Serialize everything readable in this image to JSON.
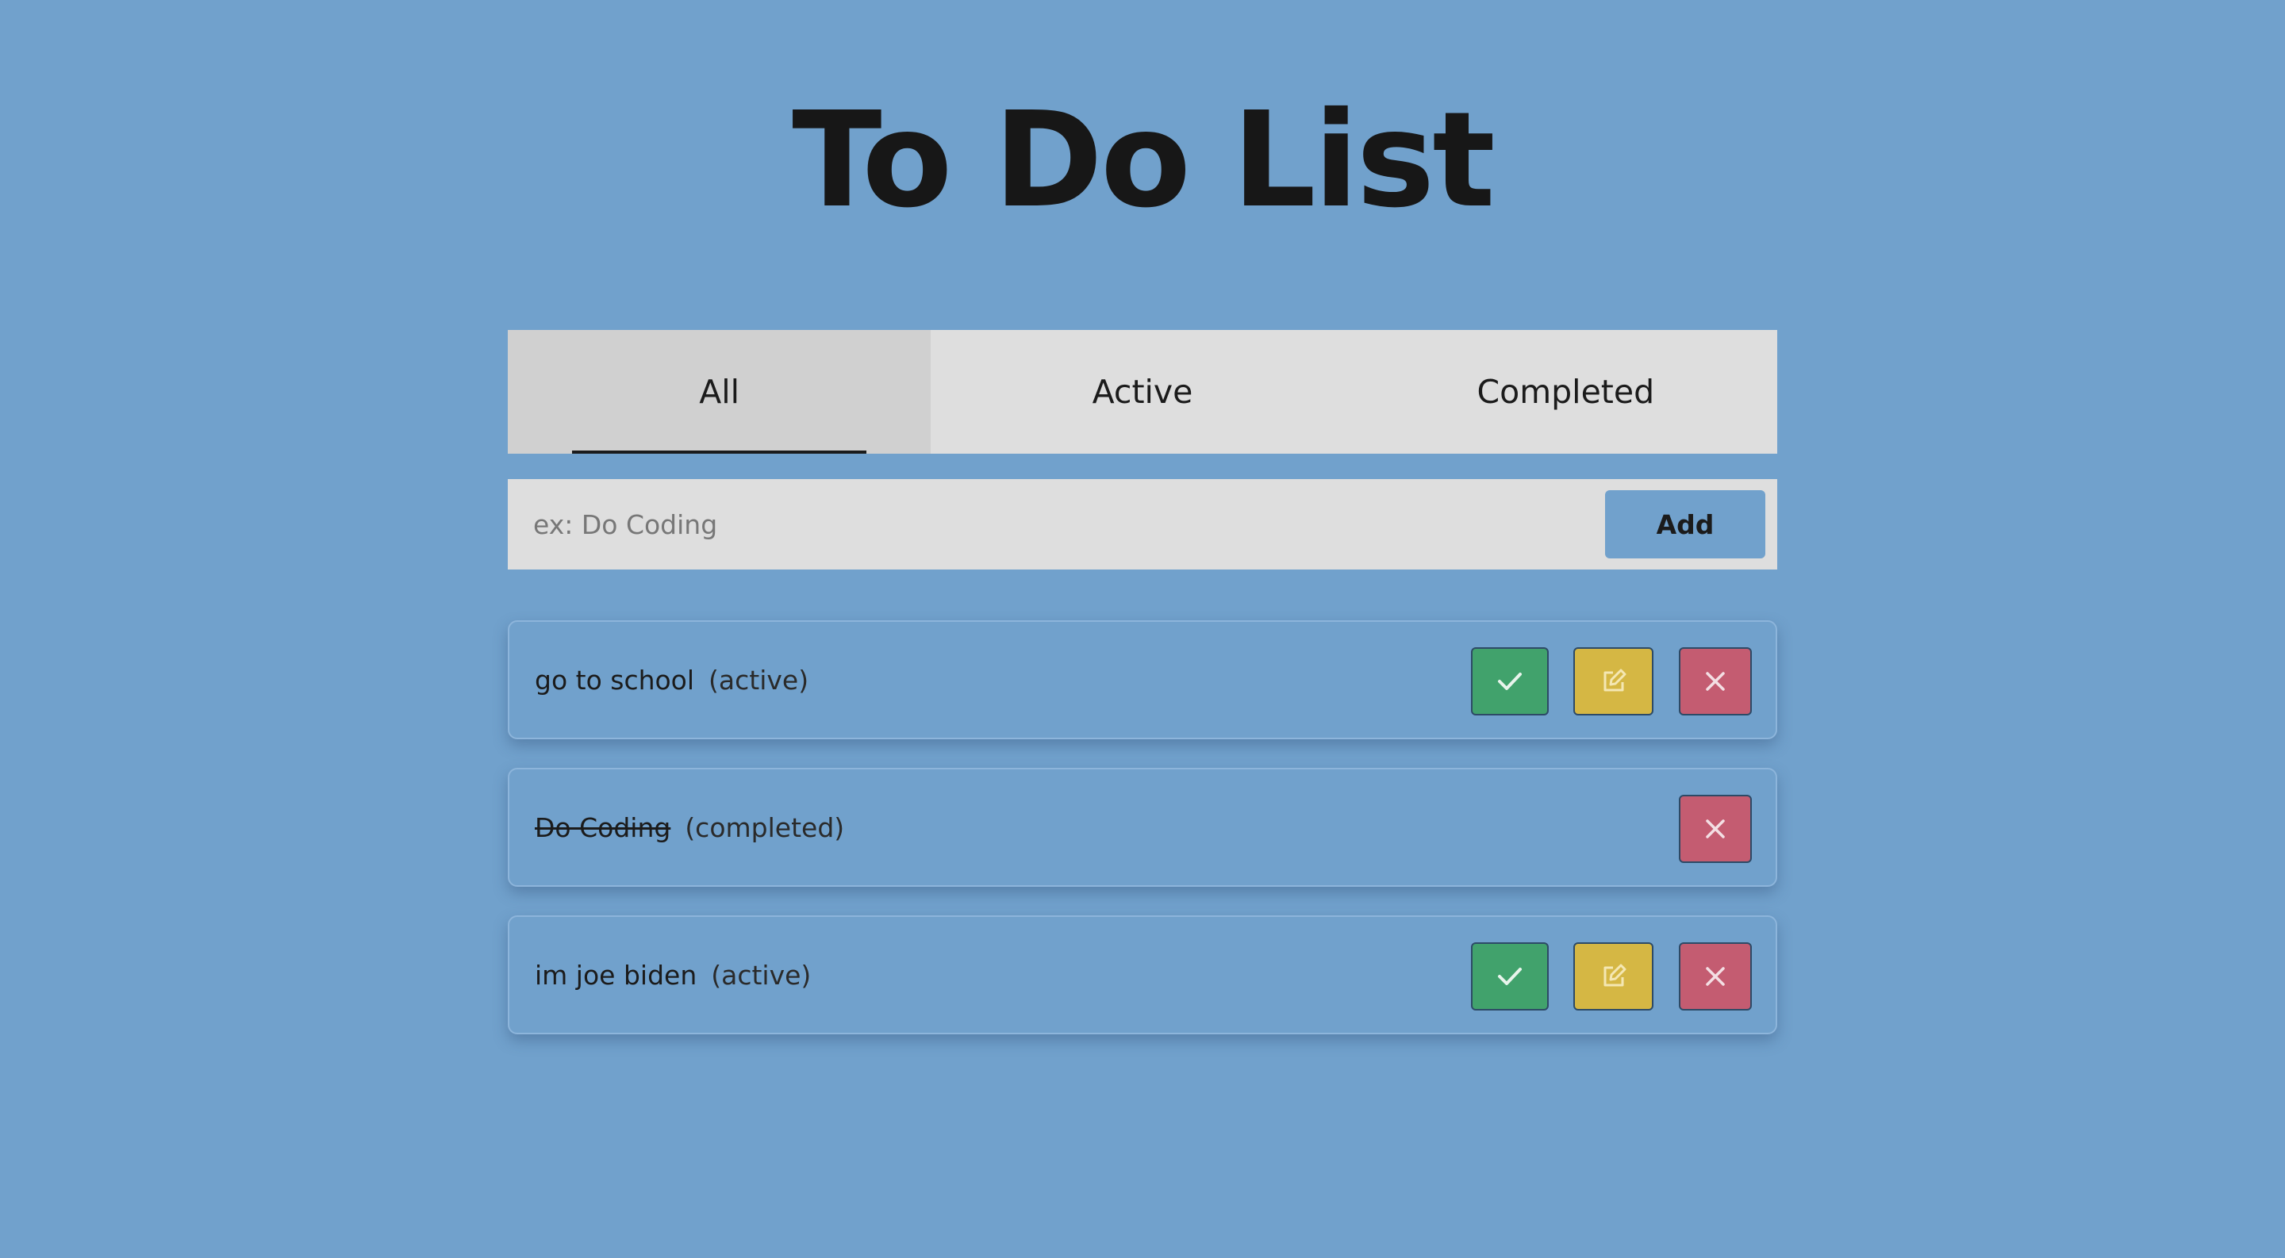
{
  "app": {
    "title": "To Do List",
    "colors": {
      "background": "#71a1cc",
      "panel": "#dedede",
      "selected_tab": "#d0d0d0",
      "complete_button": "#41a26c",
      "edit_button": "#d5b744",
      "delete_button": "#c45c71"
    }
  },
  "tabs": [
    {
      "label": "All",
      "selected": true
    },
    {
      "label": "Active",
      "selected": false
    },
    {
      "label": "Completed",
      "selected": false
    }
  ],
  "add_form": {
    "placeholder": "ex: Do Coding",
    "value": "",
    "button_label": "Add"
  },
  "todos": [
    {
      "text": "go to school",
      "status": "(active)",
      "completed": false,
      "icons": [
        "check-icon",
        "edit-icon",
        "close-icon"
      ]
    },
    {
      "text": "Do Coding",
      "status": "(completed)",
      "completed": true,
      "icons": [
        "close-icon"
      ]
    },
    {
      "text": "im joe biden",
      "status": "(active)",
      "completed": false,
      "icons": [
        "check-icon",
        "edit-icon",
        "close-icon"
      ]
    }
  ]
}
